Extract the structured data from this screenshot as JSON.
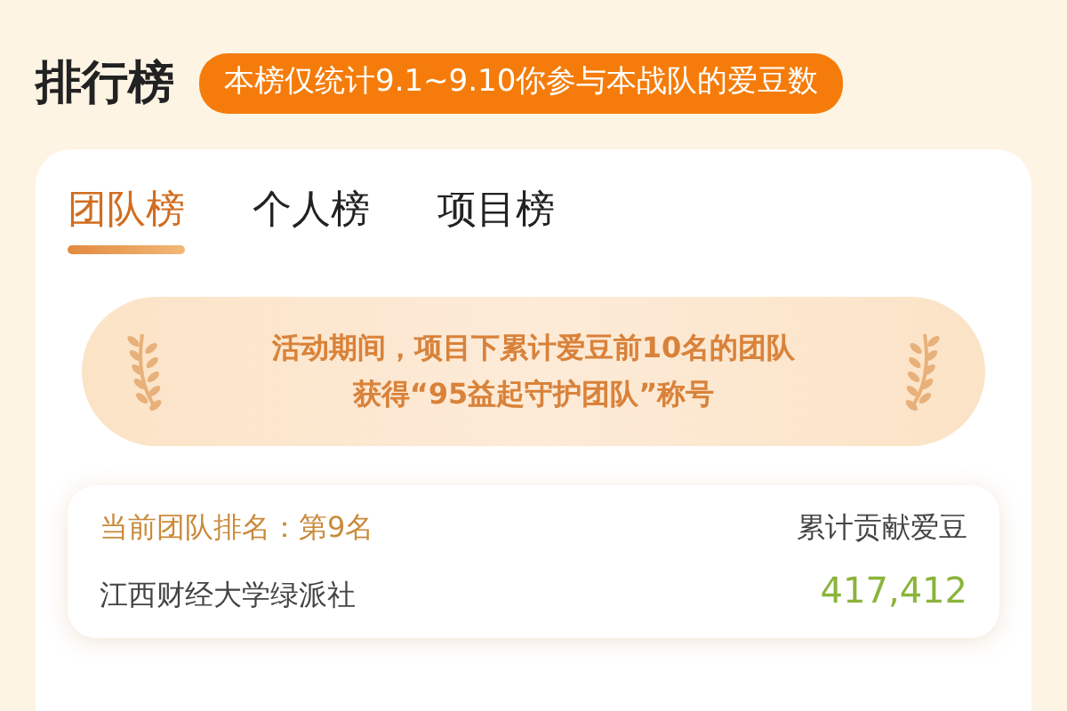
{
  "header": {
    "title": "排行榜",
    "notice": "本榜仅统计9.1~9.10你参与本战队的爱豆数"
  },
  "tabs": [
    {
      "label": "团队榜",
      "selected": true
    },
    {
      "label": "个人榜",
      "selected": false
    },
    {
      "label": "项目榜",
      "selected": false
    }
  ],
  "banner": {
    "lines": [
      "活动期间，项目下累计爱豆前10名的团队",
      "获得“95益起守护团队”称号"
    ]
  },
  "team": {
    "rank": "当前团队排名：第9名",
    "name": "江西财经大学绿派社",
    "total_label": "累计贡献爱豆",
    "total": "417,412"
  }
}
